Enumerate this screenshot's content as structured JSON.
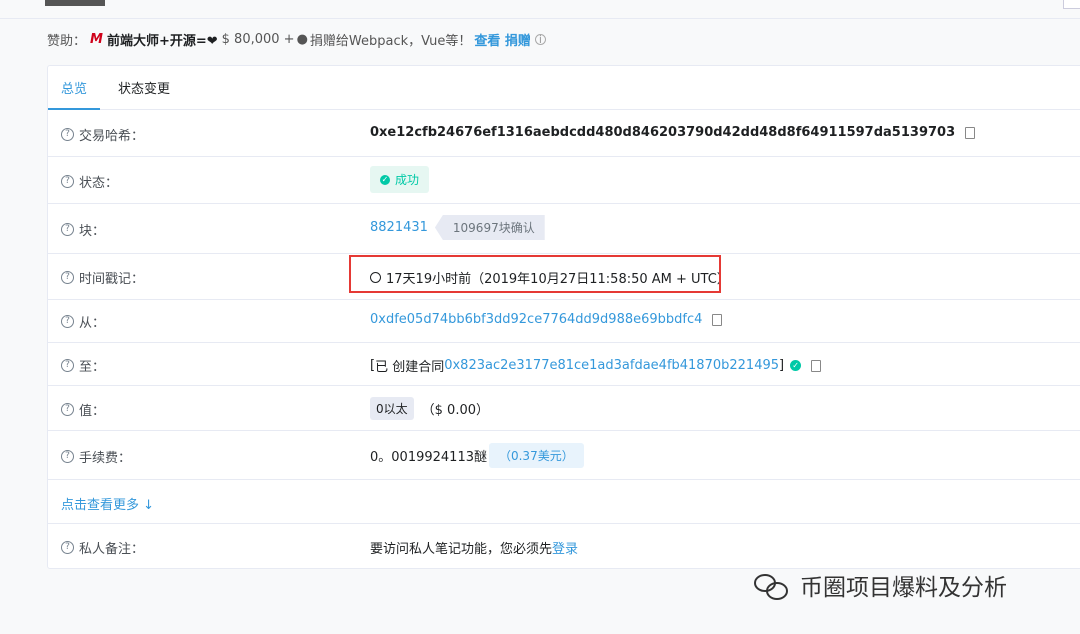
{
  "sponsor": {
    "prefix": "赞助：",
    "logo": "M",
    "brand": "前端大师+开源=❤ ",
    "amount": "$ 80,000 +",
    "icon": "moneybag-icon",
    "desc": "捐赠给Webpack，Vue等！",
    "link": "查看 捐赠"
  },
  "tabs": {
    "overview": "总览",
    "state": "状态变更"
  },
  "rows": {
    "hash": {
      "label": "交易哈希：",
      "value": "0xe12cfb24676ef1316aebdcdd480d846203790d42dd48d8f64911597da5139703"
    },
    "status": {
      "label": "状态：",
      "value": "成功"
    },
    "block": {
      "label": "块：",
      "value": "8821431",
      "confirm": "109697块确认"
    },
    "time": {
      "label": "时间戳记：",
      "value": "17天19小时前（2019年10月27日11:58:50 AM + UTC）"
    },
    "from": {
      "label": "从：",
      "value": "0xdfe05d74bb6bf3dd92ce7764dd9d988e69bbdfc4"
    },
    "to": {
      "label": "至：",
      "open": "[ ",
      "prefix": "已 创建合同",
      "value": "0x823ac2e3177e81ce1ad3afdae4fb41870b221495",
      "close": " ]"
    },
    "value": {
      "label": "值：",
      "amount": "0以太",
      "usd": "（$ 0.00）"
    },
    "fee": {
      "label": "手续费：",
      "amount": "0。0019924113醚",
      "usd": "（0.37美元）"
    },
    "note": {
      "label": "私人备注：",
      "text": "要访问私人笔记功能，您必须先",
      "link": "登录"
    }
  },
  "more": "点击查看更多  ↓",
  "watermark": "币圈项目爆料及分析"
}
